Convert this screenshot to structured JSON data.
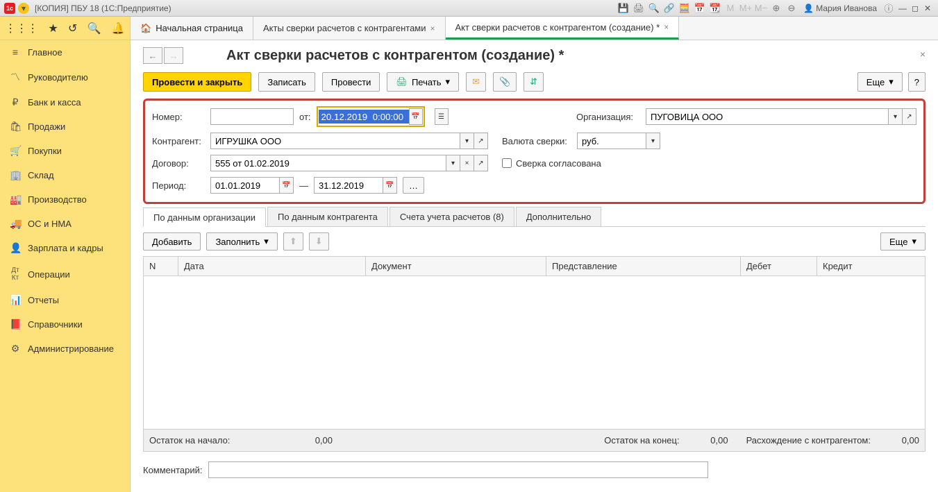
{
  "titlebar": {
    "app_title": "[КОПИЯ] ПБУ 18  (1С:Предприятие)",
    "user_name": "Мария Иванова"
  },
  "tabs": {
    "home": "Начальная страница",
    "tab1": "Акты сверки расчетов с контрагентами",
    "tab2": "Акт сверки расчетов с контрагентом (создание) *"
  },
  "sidebar": {
    "items": [
      {
        "icon": "≡",
        "label": "Главное"
      },
      {
        "icon": "📈",
        "label": "Руководителю"
      },
      {
        "icon": "₽",
        "label": "Банк и касса"
      },
      {
        "icon": "🛍",
        "label": "Продажи"
      },
      {
        "icon": "🛒",
        "label": "Покупки"
      },
      {
        "icon": "🏢",
        "label": "Склад"
      },
      {
        "icon": "🏭",
        "label": "Производство"
      },
      {
        "icon": "🚚",
        "label": "ОС и НМА"
      },
      {
        "icon": "👤",
        "label": "Зарплата и кадры"
      },
      {
        "icon": "Дт",
        "label": "Операции"
      },
      {
        "icon": "📊",
        "label": "Отчеты"
      },
      {
        "icon": "📕",
        "label": "Справочники"
      },
      {
        "icon": "⚙",
        "label": "Администрирование"
      }
    ]
  },
  "page": {
    "title": "Акт сверки расчетов с контрагентом (создание) *"
  },
  "toolbar": {
    "post_close": "Провести и закрыть",
    "record": "Записать",
    "post": "Провести",
    "print": "Печать",
    "more": "Еще"
  },
  "form": {
    "number_label": "Номер:",
    "number_value": "",
    "from_label": "от:",
    "date_value": "20.12.2019  0:00:00",
    "org_label": "Организация:",
    "org_value": "ПУГОВИЦА ООО",
    "counterparty_label": "Контрагент:",
    "counterparty_value": "ИГРУШКА ООО",
    "currency_label": "Валюта сверки:",
    "currency_value": "руб.",
    "contract_label": "Договор:",
    "contract_value": "555 от 01.02.2019",
    "agreed_label": "Сверка согласована",
    "period_label": "Период:",
    "period_from": "01.01.2019",
    "period_dash": "—",
    "period_to": "31.12.2019"
  },
  "subtabs": {
    "t1": "По данным организации",
    "t2": "По данным контрагента",
    "t3": "Счета учета расчетов (8)",
    "t4": "Дополнительно"
  },
  "subbar": {
    "add": "Добавить",
    "fill": "Заполнить",
    "more": "Еще"
  },
  "table": {
    "cols": {
      "n": "N",
      "date": "Дата",
      "doc": "Документ",
      "repr": "Представление",
      "debit": "Дебет",
      "credit": "Кредит"
    }
  },
  "footer": {
    "start_label": "Остаток на начало:",
    "start_value": "0,00",
    "end_label": "Остаток на конец:",
    "end_value": "0,00",
    "diff_label": "Расхождение с контрагентом:",
    "diff_value": "0,00"
  },
  "comment": {
    "label": "Комментарий:",
    "value": ""
  }
}
